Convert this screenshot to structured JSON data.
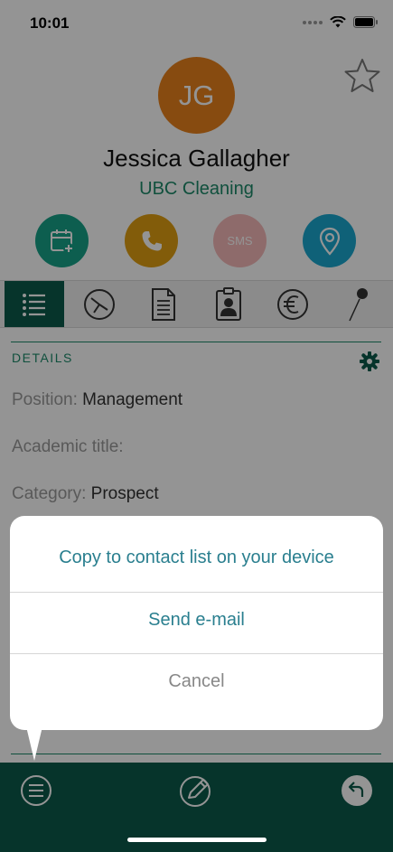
{
  "status_bar": {
    "time": "10:01"
  },
  "contact": {
    "initials": "JG",
    "name": "Jessica Gallagher",
    "company": "UBC Cleaning"
  },
  "actions": [
    {
      "id": "calendar",
      "icon": "calendar-add-icon"
    },
    {
      "id": "call",
      "icon": "phone-icon"
    },
    {
      "id": "sms",
      "label": "SMS"
    },
    {
      "id": "location",
      "icon": "location-pin-icon"
    }
  ],
  "tabs": [
    {
      "id": "details",
      "icon": "list-icon",
      "active": true
    },
    {
      "id": "activity",
      "icon": "clock-icon"
    },
    {
      "id": "documents",
      "icon": "document-icon"
    },
    {
      "id": "contact-card",
      "icon": "id-badge-icon"
    },
    {
      "id": "finance",
      "icon": "euro-icon"
    },
    {
      "id": "pin",
      "icon": "pushpin-icon"
    }
  ],
  "details": {
    "title": "DETAILS",
    "fields": [
      {
        "label": "Position:",
        "value": "Management"
      },
      {
        "label": "Academic title:",
        "value": ""
      },
      {
        "label": "Category:",
        "value": "Prospect"
      }
    ]
  },
  "sheet": {
    "copy_label": "Copy to contact list on your device",
    "email_label": "Send e-mail",
    "cancel_label": "Cancel"
  },
  "colors": {
    "accent_dark": "#0c5a4b",
    "accent_text": "#1d8a6a",
    "avatar": "#e8821d",
    "sheet_link": "#2a7f8f"
  }
}
